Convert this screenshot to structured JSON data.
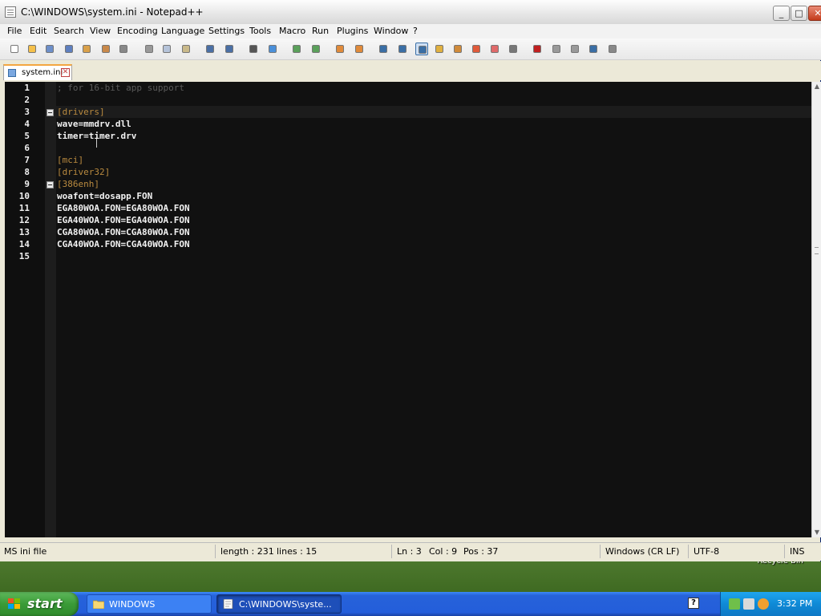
{
  "window": {
    "title": "C:\\WINDOWS\\system.ini - Notepad++",
    "minimize_glyph": "_",
    "maximize_glyph": "□",
    "close_glyph": "✕"
  },
  "menu": [
    "File",
    "Edit",
    "Search",
    "View",
    "Encoding",
    "Language",
    "Settings",
    "Tools",
    "Macro",
    "Run",
    "Plugins",
    "Window",
    "?"
  ],
  "toolbar_icons": [
    "new-icon",
    "open-icon",
    "save-icon",
    "save-all-icon",
    "close-icon",
    "close-all-icon",
    "print-icon",
    "cut-icon",
    "copy-icon",
    "paste-icon",
    "undo-icon",
    "redo-icon",
    "find-icon",
    "replace-icon",
    "zoom-in-icon",
    "zoom-out-icon",
    "sync-v-icon",
    "sync-h-icon",
    "wrap-icon",
    "show-all-chars-icon",
    "indent-guide-icon",
    "doc-map-icon",
    "function-list-icon",
    "folder-workspace-icon",
    "monitor-icon",
    "eye-icon",
    "record-macro-icon",
    "stop-macro-icon",
    "play-macro-icon",
    "run-macro-multiple-icon",
    "save-macro-icon"
  ],
  "tab": {
    "label": "system.ini",
    "close_glyph": "✕"
  },
  "editor": {
    "lines": [
      {
        "n": "1",
        "text": "; for 16-bit app support",
        "type": "comment"
      },
      {
        "n": "2",
        "text": "",
        "type": "plain"
      },
      {
        "n": "3",
        "text": "[drivers]",
        "type": "section",
        "fold": true
      },
      {
        "n": "4",
        "text": "wave=mmdrv.dll",
        "type": "plain"
      },
      {
        "n": "5",
        "text": "timer=timer.drv",
        "type": "plain"
      },
      {
        "n": "6",
        "text": "",
        "type": "plain"
      },
      {
        "n": "7",
        "text": "[mci]",
        "type": "section"
      },
      {
        "n": "8",
        "text": "[driver32]",
        "type": "section"
      },
      {
        "n": "9",
        "text": "[386enh]",
        "type": "section",
        "fold": true
      },
      {
        "n": "10",
        "text": "woafont=dosapp.FON",
        "type": "plain"
      },
      {
        "n": "11",
        "text": "EGA80WOA.FON=EGA80WOA.FON",
        "type": "plain"
      },
      {
        "n": "12",
        "text": "EGA40WOA.FON=EGA40WOA.FON",
        "type": "plain"
      },
      {
        "n": "13",
        "text": "CGA80WOA.FON=CGA80WOA.FON",
        "type": "plain"
      },
      {
        "n": "14",
        "text": "CGA40WOA.FON=CGA40WOA.FON",
        "type": "plain"
      },
      {
        "n": "15",
        "text": "",
        "type": "plain"
      }
    ]
  },
  "statusbar": {
    "filetype": "MS ini file",
    "length": "length : 231",
    "lines": "lines : 15",
    "ln": "Ln : 3",
    "col": "Col : 9",
    "pos": "Pos : 37",
    "eol": "Windows (CR LF)",
    "encoding": "UTF-8",
    "mode": "INS"
  },
  "desktop": {
    "recycle_bin": "Recycle Bin"
  },
  "taskbar": {
    "start_label": "start",
    "tasks": [
      {
        "label": "WINDOWS"
      },
      {
        "label": "C:\\WINDOWS\\syste..."
      }
    ],
    "help_glyph": "?",
    "clock": "3:32 PM"
  }
}
